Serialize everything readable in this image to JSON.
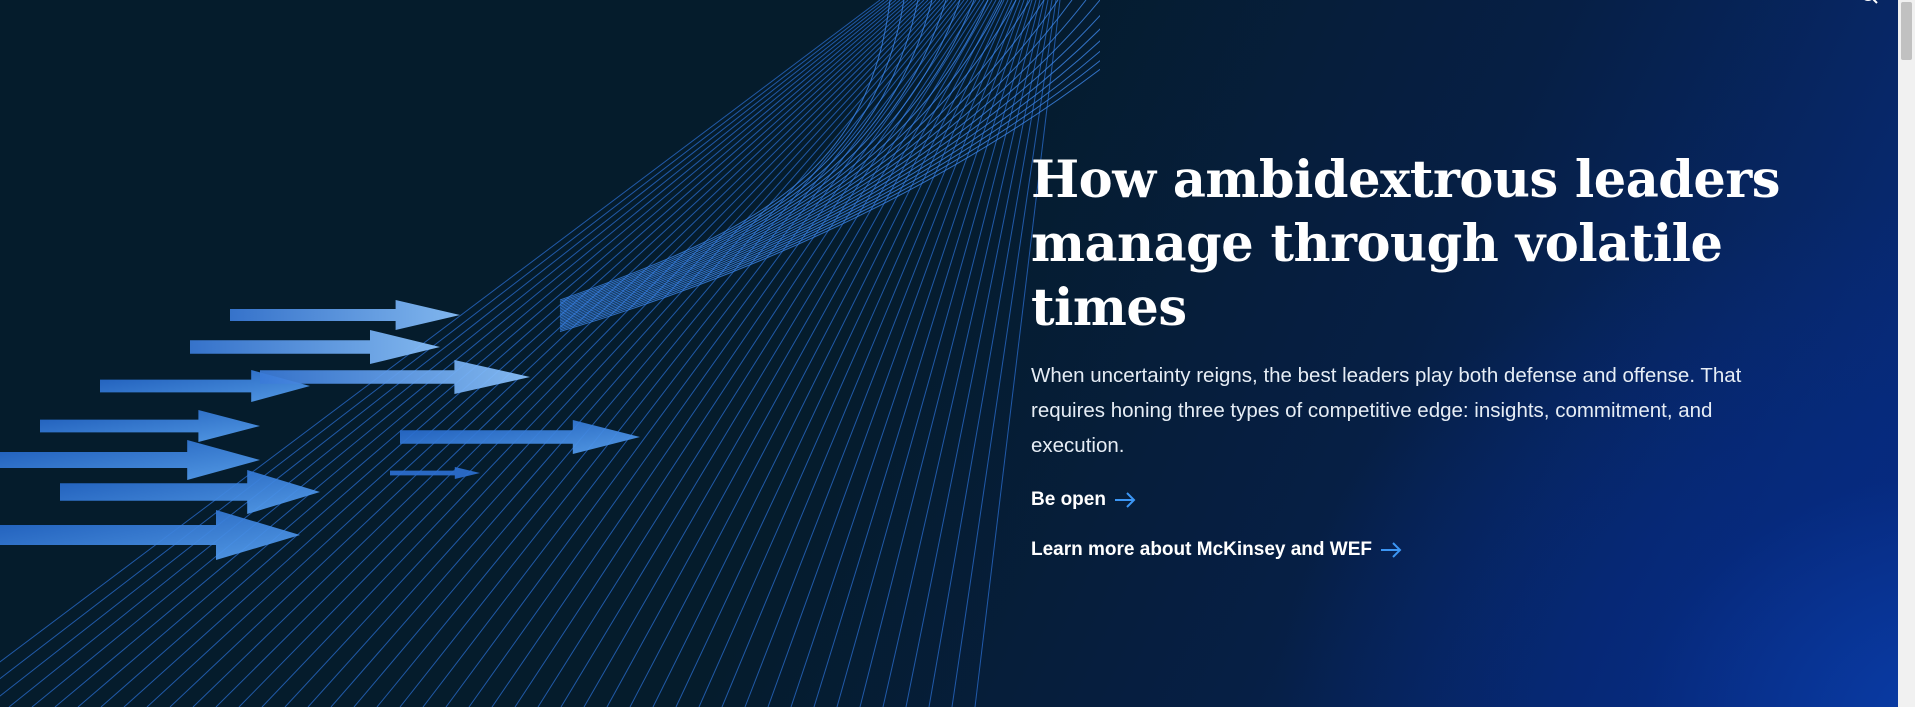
{
  "hero": {
    "headline": "How ambidextrous leaders manage through volatile times",
    "description": "When uncertainty reigns, the best leaders play both defense and offense. That requires honing three types of competitive edge: insights, commitment, and execution.",
    "links": [
      {
        "label": "Be open",
        "icon": "arrow-right-icon"
      },
      {
        "label": "Learn more about McKinsey and WEF",
        "icon": "arrow-right-icon"
      }
    ]
  },
  "colors": {
    "background": "#051c2c",
    "accent_blue": "#2251ff",
    "link_arrow": "#3c96f4",
    "text": "#ffffff"
  },
  "icons": {
    "top_right": "search-icon"
  }
}
